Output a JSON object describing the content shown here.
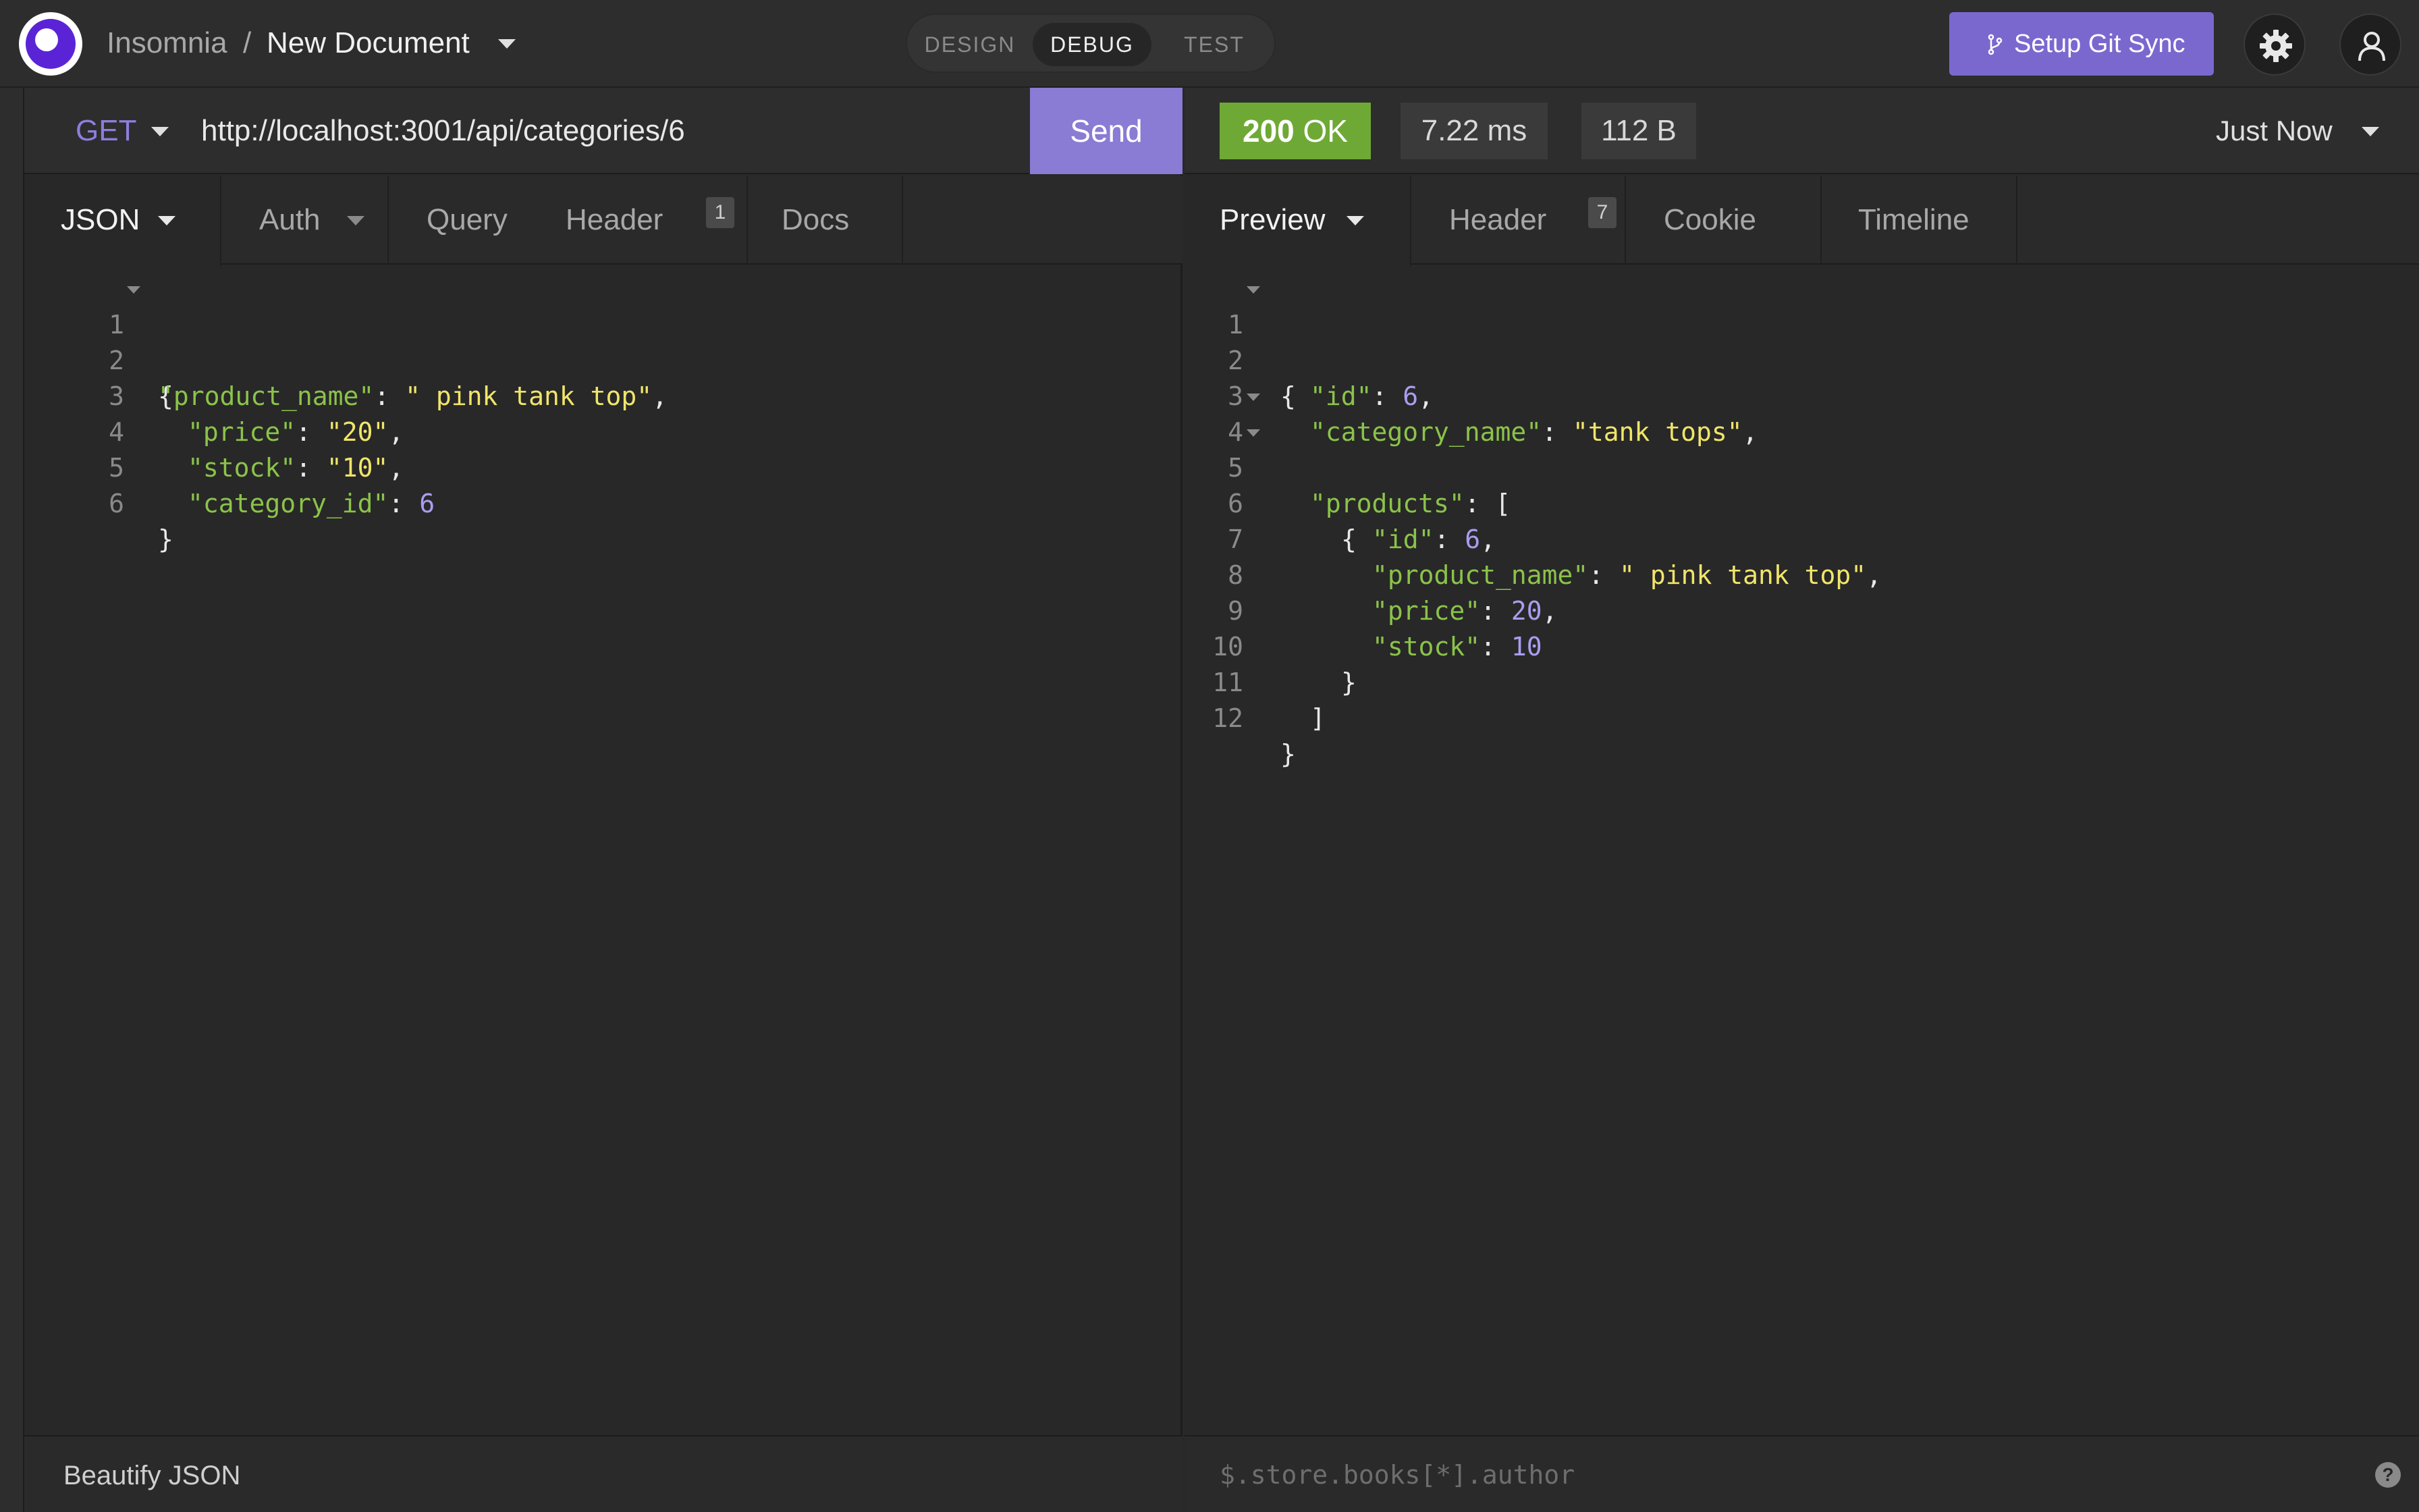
{
  "app": {
    "name": "Insomnia",
    "separator": "/",
    "document": "New Document"
  },
  "modes": {
    "design": "DESIGN",
    "debug": "DEBUG",
    "test": "TEST"
  },
  "header_actions": {
    "git_sync": "Setup Git Sync",
    "settings_icon": "gear-icon",
    "account_icon": "user-icon"
  },
  "request": {
    "method": "GET",
    "url": "http://localhost:3001/api/categories/6",
    "send_label": "Send",
    "tabs": [
      {
        "label": "JSON"
      },
      {
        "label": "Auth"
      },
      {
        "label": "Query"
      },
      {
        "label": "Header",
        "badge": "1"
      },
      {
        "label": "Docs"
      }
    ],
    "body_lines": [
      {
        "num": "1",
        "text": "{"
      },
      {
        "num": "2",
        "key": "\"product_name\"",
        "value": "\" pink tank top\"",
        "end": ","
      },
      {
        "num": "3",
        "key": "\"price\"",
        "value": "\"20\"",
        "end": ","
      },
      {
        "num": "4",
        "key": "\"stock\"",
        "value": "\"10\"",
        "end": ","
      },
      {
        "num": "5",
        "key": "\"category_id\"",
        "value": "6",
        "end": ""
      },
      {
        "num": "6",
        "text": "}"
      }
    ],
    "footer_action": "Beautify JSON"
  },
  "response": {
    "status_code": "200",
    "status_text": "OK",
    "time": "7.22 ms",
    "size": "112 B",
    "history": "Just Now",
    "tabs": [
      {
        "label": "Preview"
      },
      {
        "label": "Header",
        "badge": "7"
      },
      {
        "label": "Cookie"
      },
      {
        "label": "Timeline"
      }
    ],
    "body_lines": [
      {
        "num": "1",
        "text": "{"
      },
      {
        "num": "2",
        "key": "\"id\"",
        "value": "6",
        "end": ","
      },
      {
        "num": "3",
        "key": "\"category_name\"",
        "value": "\"tank tops\"",
        "end": ","
      },
      {
        "num": "4",
        "key": "\"products\"",
        "text": "["
      },
      {
        "num": "5",
        "text": "{"
      },
      {
        "num": "6",
        "key": "\"id\"",
        "value": "6",
        "end": ","
      },
      {
        "num": "7",
        "key": "\"product_name\"",
        "value": "\" pink tank top\"",
        "end": ","
      },
      {
        "num": "8",
        "key": "\"price\"",
        "value": "20",
        "end": ","
      },
      {
        "num": "9",
        "key": "\"stock\"",
        "value": "10",
        "end": ""
      },
      {
        "num": "10",
        "text": "}"
      },
      {
        "num": "11",
        "text": "]"
      },
      {
        "num": "12",
        "text": "}"
      }
    ],
    "filter_placeholder": "$.store.books[*].author",
    "help_label": "?"
  },
  "colors": {
    "accent": "#7b68cf",
    "status_ok": "#6fa935",
    "json_key": "#8bc34a",
    "json_string": "#f0e56a",
    "json_number": "#a99df0"
  }
}
